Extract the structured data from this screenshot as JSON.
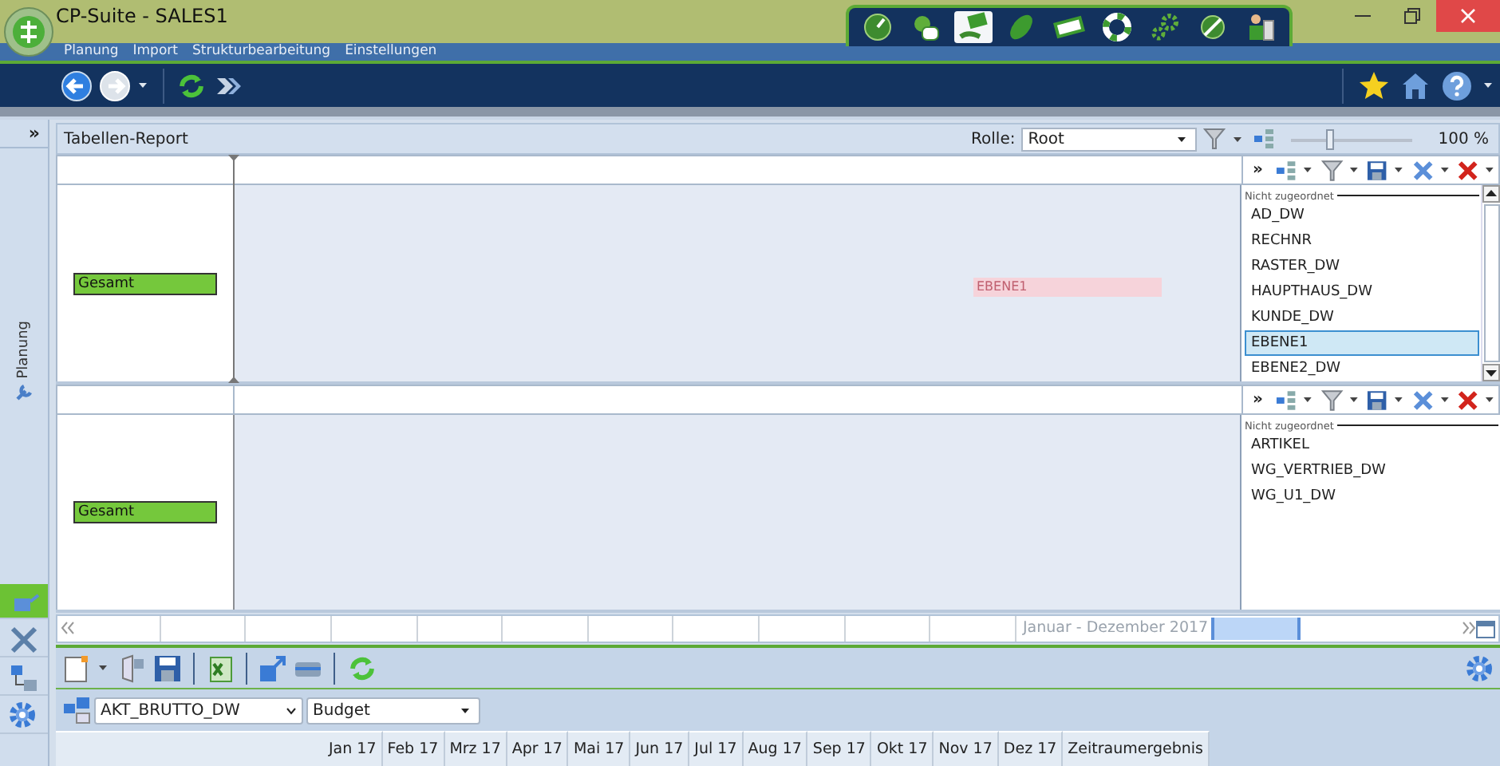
{
  "window": {
    "title": "CP-Suite - SALES1"
  },
  "module_tabs": [
    {
      "selected": false
    },
    {
      "selected": false
    },
    {
      "selected": true
    },
    {
      "selected": false
    },
    {
      "selected": false
    },
    {
      "selected": false
    },
    {
      "selected": false
    },
    {
      "selected": false
    },
    {
      "selected": false
    }
  ],
  "menu": [
    "Planung",
    "Import",
    "Strukturbearbeitung",
    "Einstellungen"
  ],
  "sidebar": {
    "expand": "»",
    "label": "Planung",
    "tools": [
      {
        "selected": true
      },
      {
        "selected": false
      },
      {
        "selected": false
      },
      {
        "selected": false
      }
    ]
  },
  "report": {
    "title": "Tabellen-Report",
    "role_label": "Rolle:",
    "role": "Root",
    "zoom": {
      "level": 0.33,
      "reading": "100 %"
    }
  },
  "panes": [
    {
      "row_label": "Gesamt",
      "field": "EBENE1",
      "panel": {
        "expand": "»",
        "heading": "Nicht zugeordnet",
        "scrollbar": true,
        "items": [
          {
            "label": "AD_DW",
            "selected": false
          },
          {
            "label": "RECHNR",
            "selected": false
          },
          {
            "label": "RASTER_DW",
            "selected": false
          },
          {
            "label": "HAUPTHAUS_DW",
            "selected": false
          },
          {
            "label": "KUNDE_DW",
            "selected": false
          },
          {
            "label": "EBENE1",
            "selected": true
          },
          {
            "label": "EBENE2_DW",
            "selected": false
          }
        ]
      }
    },
    {
      "row_label": "Gesamt",
      "panel": {
        "expand": "»",
        "heading": "Nicht zugeordnet",
        "scrollbar": false,
        "items": [
          {
            "label": "ARTIKEL",
            "selected": false
          },
          {
            "label": "WG_VERTRIEB_DW",
            "selected": false
          },
          {
            "label": "WG_U1_DW",
            "selected": false
          }
        ]
      }
    }
  ],
  "timeline": {
    "range": "Januar - Dezember 2017"
  },
  "bottom": {
    "measure": "AKT_BRUTTO_DW",
    "version": "Budget",
    "columns": [
      "Jan 17",
      "Feb 17",
      "Mrz 17",
      "Apr 17",
      "Mai 17",
      "Jun 17",
      "Jul 17",
      "Aug 17",
      "Sep 17",
      "Okt 17",
      "Nov 17",
      "Dez 17",
      "Zeitraumergebnis"
    ]
  }
}
